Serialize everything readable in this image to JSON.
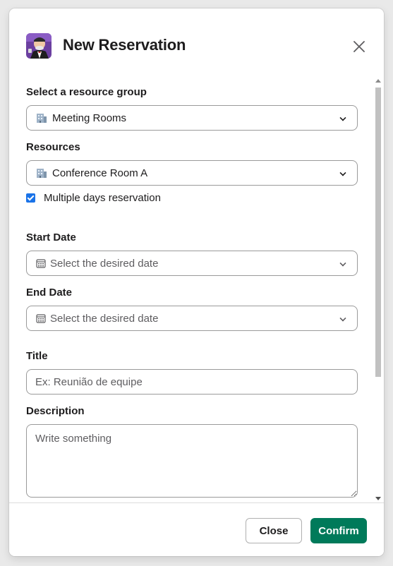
{
  "modal": {
    "title": "New Reservation",
    "close_icon": "close-x-icon"
  },
  "form": {
    "resource_group": {
      "label": "Select a resource group",
      "value": "Meeting Rooms",
      "icon": "building-emoji-icon"
    },
    "resources": {
      "label": "Resources",
      "value": "Conference Room A",
      "icon": "building-emoji-icon"
    },
    "multiple_days": {
      "label": "Multiple days reservation",
      "checked": true
    },
    "start_date": {
      "label": "Start Date",
      "placeholder": "Select the desired date",
      "icon": "calendar-icon"
    },
    "end_date": {
      "label": "End Date",
      "placeholder": "Select the desired date",
      "icon": "calendar-icon"
    },
    "title_field": {
      "label": "Title",
      "placeholder": "Ex: Reunião de equipe"
    },
    "description": {
      "label": "Description",
      "placeholder": "Write something"
    }
  },
  "footer": {
    "close_label": "Close",
    "confirm_label": "Confirm"
  },
  "colors": {
    "accent": "#007a5a",
    "checkbox": "#1a73e8"
  }
}
